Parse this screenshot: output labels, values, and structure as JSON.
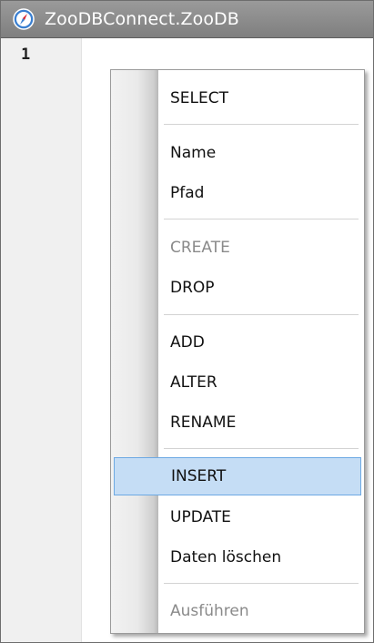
{
  "window": {
    "title": "ZooDBConnect.ZooDB",
    "icon": "compass-icon"
  },
  "editor": {
    "line_numbers": [
      "1"
    ]
  },
  "context_menu": {
    "items": [
      {
        "label": "SELECT",
        "enabled": true
      },
      {
        "label": "Name",
        "enabled": true
      },
      {
        "label": "Pfad",
        "enabled": true
      },
      {
        "label": "CREATE",
        "enabled": false
      },
      {
        "label": "DROP",
        "enabled": true
      },
      {
        "label": "ADD",
        "enabled": true
      },
      {
        "label": "ALTER",
        "enabled": true
      },
      {
        "label": "RENAME",
        "enabled": true
      },
      {
        "label": "INSERT",
        "enabled": true,
        "highlighted": true
      },
      {
        "label": "UPDATE",
        "enabled": true
      },
      {
        "label": "Daten löschen",
        "enabled": true
      },
      {
        "label": "Ausführen",
        "enabled": false
      }
    ]
  },
  "colors": {
    "titlebar": "#8a8a8a",
    "highlight_fill": "#c5ddf5",
    "highlight_border": "#6da9e3",
    "disabled_text": "#8a8a8a"
  }
}
